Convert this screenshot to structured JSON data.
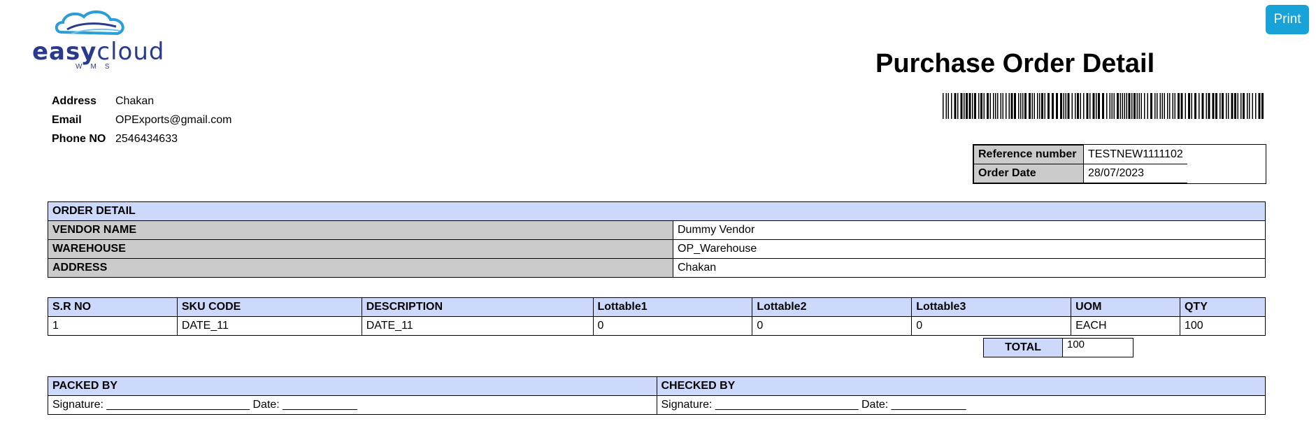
{
  "logo": {
    "brand_bold": "easy",
    "brand_light": "cloud",
    "sub": "WMS"
  },
  "print_label": "Print",
  "title": "Purchase Order Detail",
  "contact": [
    {
      "label": "Address",
      "value": "Chakan"
    },
    {
      "label": "Email",
      "value": "OPExports@gmail.com"
    },
    {
      "label": "Phone NO",
      "value": "2546434633"
    }
  ],
  "reference": {
    "ref_label": "Reference number",
    "ref_value": "TESTNEW1111102",
    "date_label": "Order Date",
    "date_value": "28/07/2023"
  },
  "order_detail": {
    "header": "ORDER DETAIL",
    "rows": [
      {
        "label": "VENDOR NAME",
        "value": "Dummy Vendor"
      },
      {
        "label": "WAREHOUSE",
        "value": "OP_Warehouse"
      },
      {
        "label": "ADDRESS",
        "value": "Chakan"
      }
    ]
  },
  "items": {
    "columns": [
      "S.R NO",
      "SKU CODE",
      "DESCRIPTION",
      "Lottable1",
      "Lottable2",
      "Lottable3",
      "UOM",
      "QTY"
    ],
    "rows": [
      [
        "1",
        "DATE_11",
        "DATE_11",
        "0",
        "0",
        "0",
        "EACH",
        "100"
      ]
    ]
  },
  "total": {
    "label": "TOTAL",
    "value": "100"
  },
  "signoff": {
    "packed_by": "PACKED BY",
    "checked_by": "CHECKED BY",
    "packed_line": "Signature: _______________________ Date: ____________",
    "checked_line": "Signature: _______________________ Date: ____________"
  },
  "colors": {
    "header_blue": "#cdd9fb",
    "label_gray": "#cbcbcb",
    "print_button": "#17a2d8"
  }
}
